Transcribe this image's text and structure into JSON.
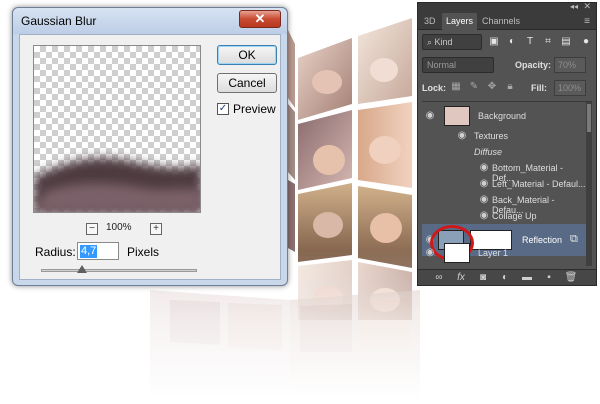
{
  "dialog": {
    "title": "Gaussian Blur",
    "close_glyph": "✕",
    "ok_label": "OK",
    "cancel_label": "Cancel",
    "preview_label": "Preview",
    "preview_checked": true,
    "zoom_level": "100%",
    "zoom_out_glyph": "−",
    "zoom_in_glyph": "+",
    "radius_label": "Radius:",
    "radius_value": "4,7",
    "radius_unit": "Pixels",
    "radius_slider_fraction": 0.26
  },
  "panel": {
    "tabs": [
      {
        "label": "3D",
        "active": false
      },
      {
        "label": "Layers",
        "active": true
      },
      {
        "label": "Channels",
        "active": false
      }
    ],
    "collapse_glyph": "◂◂",
    "close_glyph": "✕",
    "menu_glyph": "≡",
    "filter_kind": "Kind",
    "filter_icons": [
      "image-filter-icon",
      "adjustment-filter-icon",
      "type-filter-icon",
      "shape-filter-icon",
      "smart-object-filter-icon",
      "filter-toggle-icon"
    ],
    "blend_mode": "Normal",
    "opacity_label": "Opacity:",
    "opacity_value": "70%",
    "lock_label": "Lock:",
    "fill_label": "Fill:",
    "fill_value": "100%",
    "layers": [
      {
        "name": "Background",
        "type": "layer"
      },
      {
        "name": "Textures",
        "type": "group"
      },
      {
        "name": "Diffuse",
        "type": "header"
      },
      {
        "name": "Bottom_Material - Def...",
        "type": "texture"
      },
      {
        "name": "Left_Material - Defaul...",
        "type": "texture"
      },
      {
        "name": "Back_Material - Defau...",
        "type": "texture"
      },
      {
        "name": "Collage Up",
        "type": "texture"
      },
      {
        "name": "Reflection",
        "type": "layer",
        "selected": true
      },
      {
        "name": "Layer 1",
        "type": "layer"
      }
    ],
    "bottom_icons": [
      "link-icon",
      "fx-icon",
      "mask-icon",
      "adjustment-icon",
      "group-folder-icon",
      "new-layer-icon",
      "trash-icon"
    ],
    "fx_label": "fx"
  },
  "colors": {
    "panel_bg": "#535353",
    "selected_row": "#586a85",
    "highlight_circle": "#d01818",
    "dialog_frame": "#c9d7eb"
  }
}
